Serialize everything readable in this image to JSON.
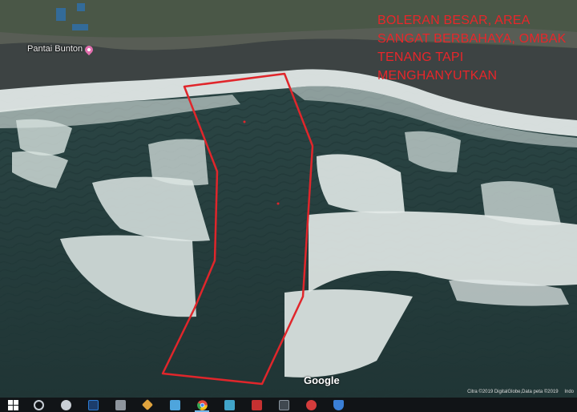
{
  "map": {
    "place_label": "Pantai Bunton",
    "annotation_lines": [
      "BOLERAN BESAR, AREA",
      "SANGAT BERBAHAYA, OMBAK",
      "TENANG TAPI",
      "MENGHANYUTKAN"
    ],
    "annotation_color": "#e8262a",
    "google_logo": "Google",
    "attribution": {
      "imagery": "Citra ©2019 DigitalGlobe,Data peta ©2019",
      "suffix": "Indo"
    },
    "colors": {
      "sea": "#264040",
      "foam": "#e3ebea",
      "shore": "#3d4242",
      "land": "#4c5a48"
    }
  },
  "taskbar": {
    "items": [
      {
        "name": "windows-start",
        "color": "#111417"
      },
      {
        "name": "cortana-search",
        "color": "#2b2f33"
      },
      {
        "name": "app-chrome-alt",
        "color": "#c9cfd6"
      },
      {
        "name": "app-photoshop",
        "color": "#2b7bd3"
      },
      {
        "name": "app-calculator",
        "color": "#8f969e"
      },
      {
        "name": "app-tools",
        "color": "#e0a33d"
      },
      {
        "name": "app-file-explorer",
        "color": "#4ea5dd"
      },
      {
        "name": "app-chrome",
        "color": "#e3493f"
      },
      {
        "name": "app-media",
        "color": "#41a4c9"
      },
      {
        "name": "app-red-game",
        "color": "#c63131"
      },
      {
        "name": "app-terminal",
        "color": "#404850"
      },
      {
        "name": "app-red-app",
        "color": "#d43c3c"
      },
      {
        "name": "app-blue-shield",
        "color": "#3a7fd6"
      }
    ],
    "active_item": "app-chrome"
  }
}
